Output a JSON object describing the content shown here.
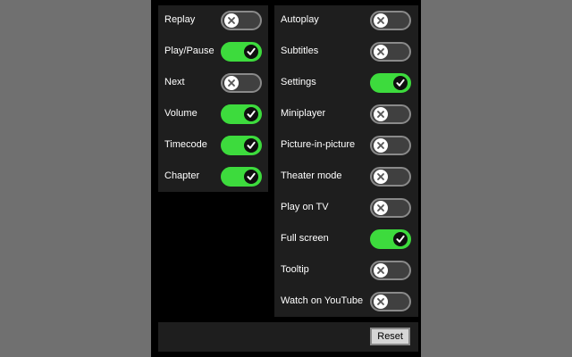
{
  "colors": {
    "background": "#707070",
    "panel": "#000000",
    "column": "#1e1e1e",
    "toggle_on": "#3ddb3d",
    "toggle_off": "#404040"
  },
  "left_column": [
    {
      "label": "Replay",
      "enabled": false
    },
    {
      "label": "Play/Pause",
      "enabled": true
    },
    {
      "label": "Next",
      "enabled": false
    },
    {
      "label": "Volume",
      "enabled": true
    },
    {
      "label": "Timecode",
      "enabled": true
    },
    {
      "label": "Chapter",
      "enabled": true
    }
  ],
  "right_column": [
    {
      "label": "Autoplay",
      "enabled": false
    },
    {
      "label": "Subtitles",
      "enabled": false
    },
    {
      "label": "Settings",
      "enabled": true
    },
    {
      "label": "Miniplayer",
      "enabled": false
    },
    {
      "label": "Picture-in-picture",
      "enabled": false
    },
    {
      "label": "Theater mode",
      "enabled": false
    },
    {
      "label": "Play on TV",
      "enabled": false
    },
    {
      "label": "Full screen",
      "enabled": true
    },
    {
      "label": "Tooltip",
      "enabled": false
    },
    {
      "label": "Watch on YouTube",
      "enabled": false
    }
  ],
  "footer": {
    "reset_label": "Reset"
  }
}
